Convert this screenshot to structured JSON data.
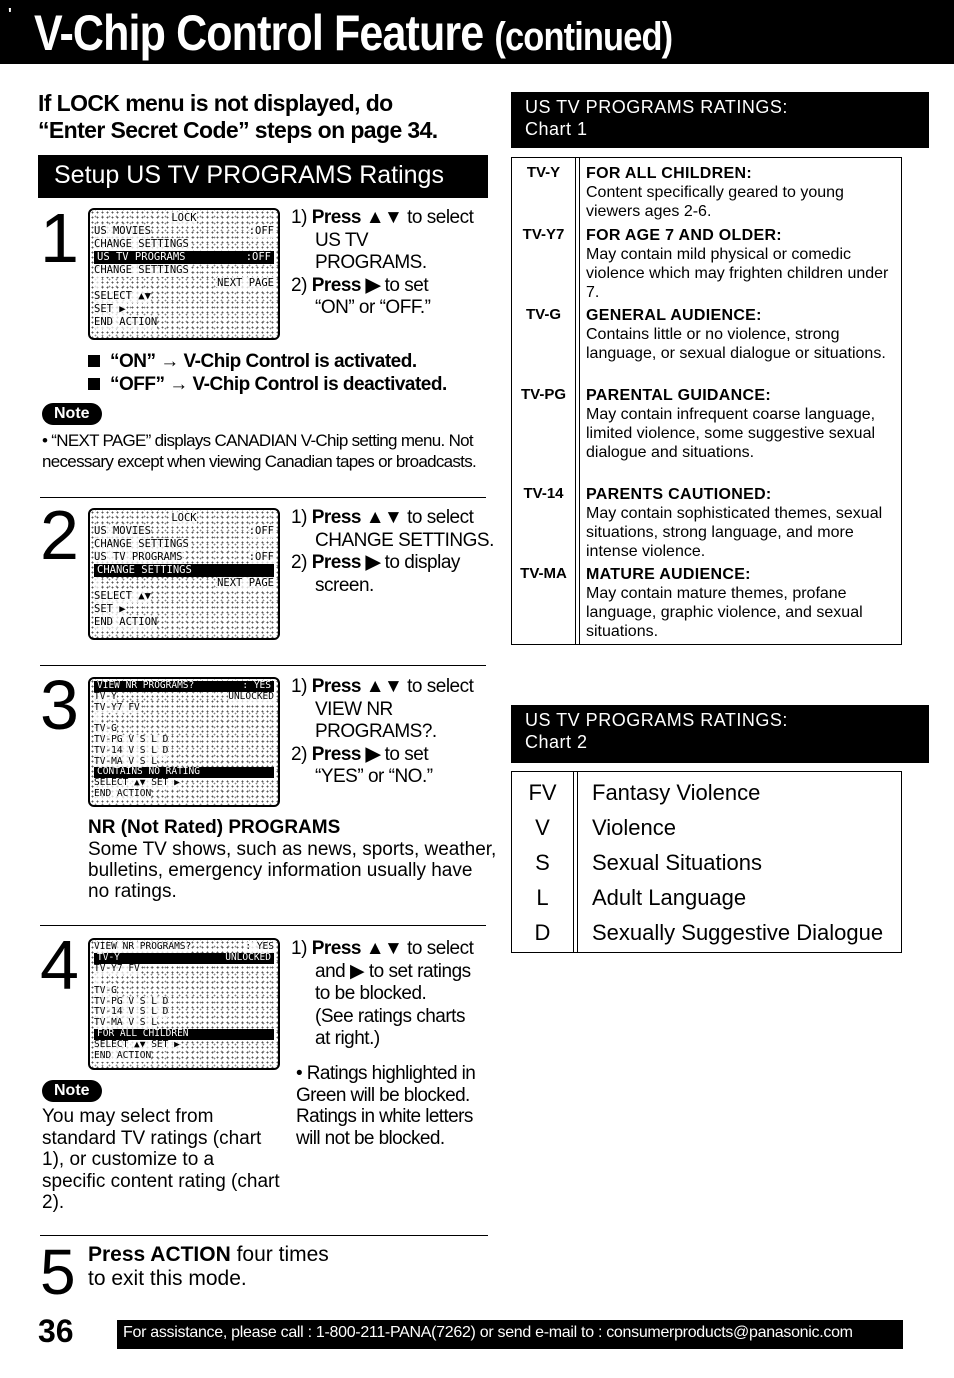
{
  "header": {
    "title": "V-Chip Control Feature",
    "subtitle": "(continued)"
  },
  "intro": {
    "line1": "If LOCK menu is not displayed, do",
    "line2": "“Enter Secret Code” steps on page 34."
  },
  "section_heading": "Setup US TV PROGRAMS Ratings",
  "steps": [
    {
      "number": "1",
      "osd": [
        {
          "left": "LOCK",
          "right": "",
          "highlight": false,
          "center": true
        },
        {
          "left": "US MOVIES",
          "right": ":OFF",
          "highlight": false
        },
        {
          "left": "  CHANGE SETTINGS",
          "right": "",
          "highlight": false
        },
        {
          "left": "US TV PROGRAMS",
          "right": ":OFF",
          "highlight": true
        },
        {
          "left": "  CHANGE SETTINGS",
          "right": "",
          "highlight": false
        },
        {
          "left": "",
          "right": "NEXT PAGE",
          "highlight": false
        },
        {
          "left": "SELECT ▲▼",
          "right": "",
          "highlight": false
        },
        {
          "left": "SET ▶",
          "right": "",
          "highlight": false
        },
        {
          "left": "END  ACTION",
          "right": "",
          "highlight": false
        }
      ],
      "instructions": [
        {
          "num": "1)",
          "bold": "Press ▲▼",
          "text": " to select",
          "cont": [
            "US TV",
            "PROGRAMS."
          ]
        },
        {
          "num": "2)",
          "bold": "Press ▶",
          "text": " to set",
          "cont": [
            "“ON” or “OFF.”"
          ]
        }
      ],
      "bullets": [
        "“ON” → V-Chip Control is activated.",
        "“OFF” → V-Chip Control is deactivated."
      ],
      "note_label": "Note",
      "note_text": "• “NEXT PAGE” displays CANADIAN V-Chip setting menu. Not necessary except when viewing Canadian tapes or broadcasts."
    },
    {
      "number": "2",
      "osd": [
        {
          "left": "LOCK",
          "right": "",
          "highlight": false,
          "center": true
        },
        {
          "left": "US MOVIES",
          "right": ":OFF",
          "highlight": false
        },
        {
          "left": "  CHANGE SETTINGS",
          "right": "",
          "highlight": false
        },
        {
          "left": "US TV PROGRAMS",
          "right": ":OFF",
          "highlight": false
        },
        {
          "left": "  CHANGE SETTINGS",
          "right": "",
          "highlight": true
        },
        {
          "left": "",
          "right": "NEXT PAGE",
          "highlight": false
        },
        {
          "left": "SELECT ▲▼",
          "right": "",
          "highlight": false
        },
        {
          "left": "SET ▶",
          "right": "",
          "highlight": false
        },
        {
          "left": "END  ACTION",
          "right": "",
          "highlight": false
        }
      ],
      "instructions": [
        {
          "num": "1)",
          "bold": "Press ▲▼",
          "text": " to select",
          "cont": [
            "CHANGE SETTINGS."
          ]
        },
        {
          "num": "2)",
          "bold": "Press ▶",
          "text": " to display",
          "cont": [
            "screen."
          ]
        }
      ]
    },
    {
      "number": "3",
      "osd": [
        {
          "left": "VIEW NR PROGRAMS?",
          "right": ": YES",
          "highlight": true
        },
        {
          "left": "TV-Y",
          "right": "UNLOCKED",
          "highlight": false
        },
        {
          "left": "TV-Y7     FV",
          "right": "",
          "highlight": false
        },
        {
          "left": "",
          "right": "",
          "highlight": false
        },
        {
          "left": "TV-G",
          "right": "",
          "highlight": false
        },
        {
          "left": "TV-PG    V S L D",
          "right": "",
          "highlight": false
        },
        {
          "left": "TV-14    V S L D",
          "right": "",
          "highlight": false
        },
        {
          "left": "TV-MA    V S L",
          "right": "",
          "highlight": false
        },
        {
          "left": "CONTAINS NO RATING",
          "right": "",
          "highlight": true
        },
        {
          "left": "SELECT ▲▼  SET ▶",
          "right": "",
          "highlight": false
        },
        {
          "left": "END  ACTION",
          "right": "",
          "highlight": false
        }
      ],
      "instructions": [
        {
          "num": "1)",
          "bold": "Press ▲▼",
          "text": " to select",
          "cont": [
            "VIEW NR",
            "PROGRAMS?."
          ]
        },
        {
          "num": "2)",
          "bold": "Press ▶",
          "text": " to set",
          "cont": [
            "“YES” or “NO.”"
          ]
        }
      ],
      "nr_heading": "NR (Not Rated) PROGRAMS",
      "nr_text": "Some TV shows, such as news, sports, weather, bulletins, emergency information usually have no ratings."
    },
    {
      "number": "4",
      "osd": [
        {
          "left": "VIEW NR PROGRAMS?",
          "right": ": YES",
          "highlight": false
        },
        {
          "left": "TV-Y",
          "right": "UNLOCKED",
          "highlight": true
        },
        {
          "left": "TV-Y7     FV",
          "right": "",
          "highlight": false
        },
        {
          "left": "",
          "right": "",
          "highlight": false
        },
        {
          "left": "TV-G",
          "right": "",
          "highlight": false
        },
        {
          "left": "TV-PG    V S L D",
          "right": "",
          "highlight": false
        },
        {
          "left": "TV-14    V S L D",
          "right": "",
          "highlight": false
        },
        {
          "left": "TV-MA    V S L",
          "right": "",
          "highlight": false
        },
        {
          "left": "FOR ALL CHILDREN",
          "right": "",
          "highlight": true
        },
        {
          "left": "SELECT ▲▼  SET ▶",
          "right": "",
          "highlight": false
        },
        {
          "left": "END  ACTION",
          "right": "",
          "highlight": false
        }
      ],
      "instructions": [
        {
          "num": "1)",
          "bold": "Press ▲▼",
          "text": " to select",
          "cont": [
            "and ▶ to set ratings",
            "to be blocked.",
            "(See ratings charts",
            "at right.)"
          ]
        }
      ],
      "bullet": "• Ratings highlighted in Green will be blocked. Ratings in white letters will not be blocked.",
      "note_label": "Note",
      "note_text": "You may select from standard TV ratings (chart 1), or customize to a specific content rating (chart 2)."
    },
    {
      "number": "5",
      "bold": "Press ACTION",
      "text": " four times",
      "line2": "to exit this mode."
    }
  ],
  "chart1": {
    "title_line1": "US TV PROGRAMS RATINGS:",
    "title_line2": "Chart 1",
    "entries": [
      {
        "rating": "TV-Y",
        "title": "FOR ALL CHILDREN:",
        "desc": "Content specifically geared to young viewers ages 2-6."
      },
      {
        "rating": "TV-Y7",
        "title": "FOR AGE 7 AND OLDER:",
        "desc": "May contain mild physical or comedic violence which may frighten children under 7."
      },
      {
        "rating": "TV-G",
        "title": "GENERAL AUDIENCE:",
        "desc": "Contains little or no violence, strong language, or sexual dialogue or situations."
      },
      {
        "rating": "TV-PG",
        "title": "PARENTAL GUIDANCE:",
        "desc": "May contain infrequent coarse language, limited violence, some suggestive sexual dialogue and situations."
      },
      {
        "rating": "TV-14",
        "title": "PARENTS CAUTIONED:",
        "desc": "May contain sophisticated themes, sexual situations, strong language, and more intense violence."
      },
      {
        "rating": "TV-MA",
        "title": "MATURE AUDIENCE:",
        "desc": "May contain mature themes, profane language, graphic violence, and sexual situations."
      }
    ]
  },
  "chart2": {
    "title_line1": "US TV PROGRAMS RATINGS:",
    "title_line2": "Chart 2",
    "entries": [
      {
        "code": "FV",
        "desc": "Fantasy Violence"
      },
      {
        "code": "V",
        "desc": "Violence"
      },
      {
        "code": "S",
        "desc": "Sexual Situations"
      },
      {
        "code": "L",
        "desc": "Adult Language"
      },
      {
        "code": "D",
        "desc": "Sexually Suggestive Dialogue"
      }
    ]
  },
  "footer": {
    "page_number": "36",
    "assistance": "For assistance, please call : 1-800-211-PANA(7262) or send e-mail to : consumerproducts@panasonic.com"
  }
}
